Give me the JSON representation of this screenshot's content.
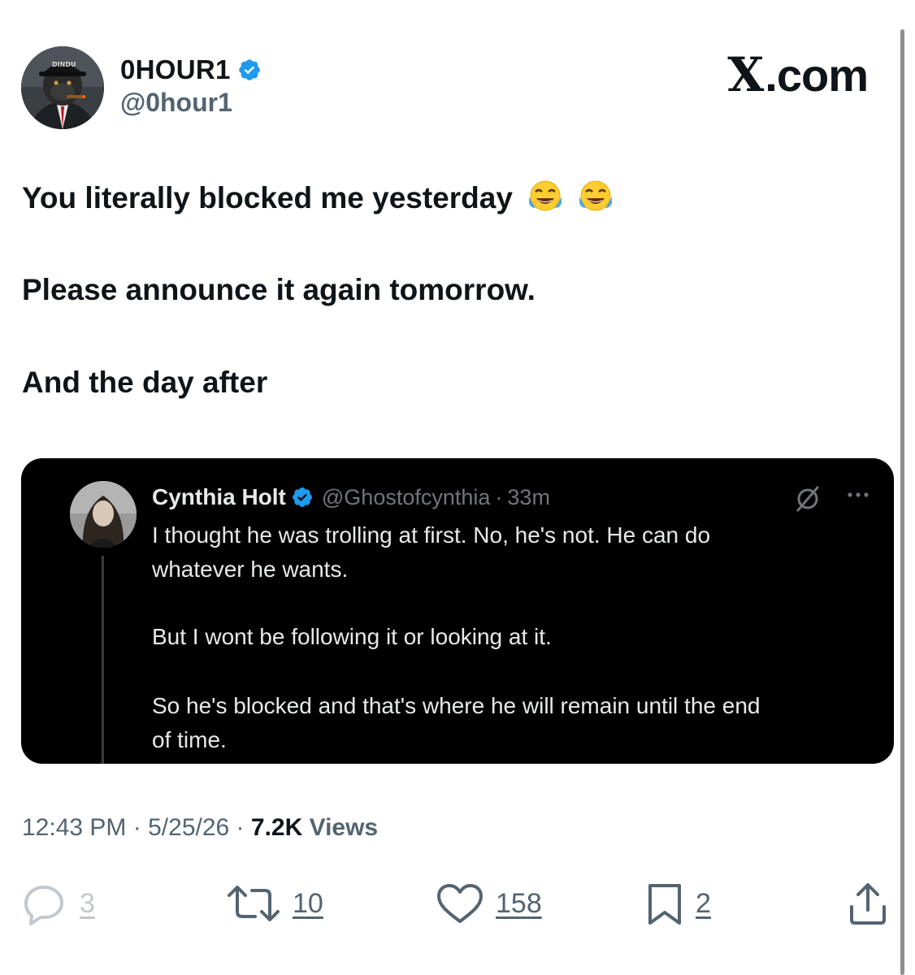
{
  "post": {
    "author": {
      "display_name": "0HOUR1",
      "handle": "@0hour1",
      "avatar_cap_text": "DINDU",
      "verified": true
    },
    "brand": "X.com",
    "lines": [
      "You literally blocked me yesterday",
      "Please announce it again tomorrow.",
      "And the day after"
    ],
    "emoji": "face-with-tears-of-joy"
  },
  "quote": {
    "name": "Cynthia Holt",
    "handle": "@Ghostofcynthia",
    "dot": "·",
    "time": "33m",
    "lines": [
      "I thought he was trolling at first. No, he's not. He can do",
      "whatever he wants.",
      "But I wont be following it or looking at it.",
      "So he's blocked and that's where he will remain until the end",
      "of time."
    ]
  },
  "meta": {
    "time": "12:43 PM",
    "sep": "·",
    "date": "5/25/26",
    "views_count": "7.2K",
    "views_label": "Views"
  },
  "actions": {
    "replies": "3",
    "reposts": "10",
    "likes": "158",
    "bookmarks": "2"
  },
  "colors": {
    "text": "#0f1419",
    "secondary": "#536471",
    "verified_blue": "#1d9bf0",
    "quote_bg": "#000000",
    "quote_text": "#e7e9ea",
    "quote_muted": "#71767b"
  }
}
